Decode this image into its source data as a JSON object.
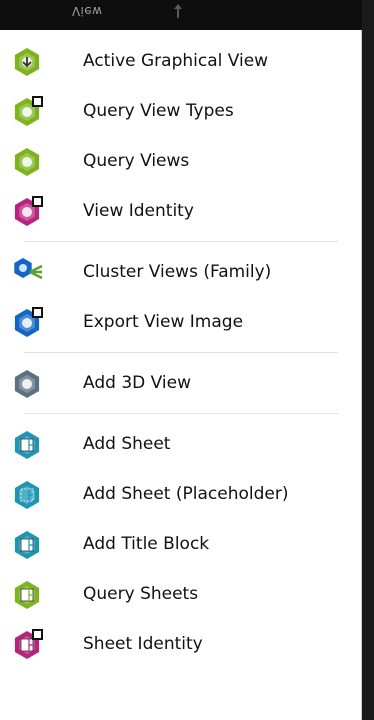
{
  "header": {
    "title": "View"
  },
  "colors": {
    "green": "#7cb31f",
    "magenta": "#b8237f",
    "blue": "#1466c4",
    "teal": "#1d96b4",
    "gray": "#5c7180"
  },
  "groups": [
    {
      "items": [
        {
          "label": "Active Graphical View",
          "icon": "active-view-hex-icon",
          "color": "green"
        },
        {
          "label": "Query View Types",
          "icon": "query-view-types-hex-icon",
          "color": "green"
        },
        {
          "label": "Query Views",
          "icon": "query-views-hex-icon",
          "color": "green"
        },
        {
          "label": "View Identity",
          "icon": "view-identity-hex-icon",
          "color": "magenta"
        }
      ]
    },
    {
      "items": [
        {
          "label": "Cluster Views (Family)",
          "icon": "cluster-views-icon",
          "color": "blue"
        },
        {
          "label": "Export View Image",
          "icon": "export-view-image-hex-icon",
          "color": "blue"
        }
      ]
    },
    {
      "items": [
        {
          "label": "Add 3D View",
          "icon": "add-3d-view-hex-icon",
          "color": "gray"
        }
      ]
    },
    {
      "items": [
        {
          "label": "Add Sheet",
          "icon": "add-sheet-hex-icon",
          "color": "teal"
        },
        {
          "label": "Add Sheet (Placeholder)",
          "icon": "add-sheet-placeholder-hex-icon",
          "color": "teal"
        },
        {
          "label": "Add Title Block",
          "icon": "add-title-block-hex-icon",
          "color": "teal"
        },
        {
          "label": "Query Sheets",
          "icon": "query-sheets-hex-icon",
          "color": "green"
        },
        {
          "label": "Sheet Identity",
          "icon": "sheet-identity-hex-icon",
          "color": "magenta"
        }
      ]
    }
  ]
}
